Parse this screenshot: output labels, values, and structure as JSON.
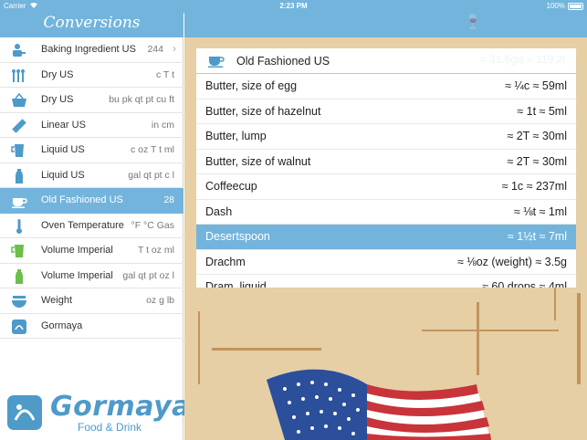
{
  "status_bar": {
    "carrier": "Carrier",
    "time": "2:23 PM",
    "battery": "100%"
  },
  "sidebar": {
    "title": "Conversions",
    "items": [
      {
        "label": "Baking Ingredient US",
        "detail": "244",
        "icon": "baking-ingredient-icon",
        "chevron": true,
        "selected": false
      },
      {
        "label": "Dry US",
        "detail": "c T t",
        "icon": "utensils-icon",
        "selected": false
      },
      {
        "label": "Dry US",
        "detail": "bu pk qt pt cu ft",
        "icon": "basket-icon",
        "selected": false
      },
      {
        "label": "Linear US",
        "detail": "in cm",
        "icon": "ruler-icon",
        "selected": false
      },
      {
        "label": "Liquid US",
        "detail": "c oz T t ml",
        "icon": "measuring-cup-icon",
        "selected": false
      },
      {
        "label": "Liquid US",
        "detail": "gal qt pt c l",
        "icon": "milk-bottle-icon",
        "selected": false
      },
      {
        "label": "Old Fashioned US",
        "detail": "28",
        "icon": "teacup-icon",
        "selected": true
      },
      {
        "label": "Oven Temperature",
        "detail": "°F °C Gas",
        "icon": "thermometer-icon",
        "selected": false
      },
      {
        "label": "Volume Imperial",
        "detail": "T t oz ml",
        "icon": "measuring-jug-icon",
        "selected": false
      },
      {
        "label": "Volume Imperial",
        "detail": "gal qt pt oz l",
        "icon": "bottle-icon",
        "selected": false
      },
      {
        "label": "Weight",
        "detail": "oz g lb",
        "icon": "scale-icon",
        "selected": false
      },
      {
        "label": "Gormaya",
        "detail": "",
        "icon": "gormaya-logo-icon",
        "selected": false
      }
    ]
  },
  "brand": {
    "name": "Gormaya",
    "tagline": "Food & Drink"
  },
  "detail": {
    "title": "Old Fashioned US",
    "header_ghost": "≈ 31.6gill ≈ 119.2l",
    "rows": [
      {
        "label": "Butter, size of egg",
        "value": "≈ ¼c ≈ 59ml",
        "selected": false
      },
      {
        "label": "Butter, size of hazelnut",
        "value": "≈ 1t ≈ 5ml",
        "selected": false
      },
      {
        "label": "Butter, lump",
        "value": "≈ 2T ≈ 30ml",
        "selected": false
      },
      {
        "label": "Butter, size of walnut",
        "value": "≈ 2T ≈ 30ml",
        "selected": false
      },
      {
        "label": "Coffeecup",
        "value": "≈ 1c ≈ 237ml",
        "selected": false
      },
      {
        "label": "Dash",
        "value": "≈ ⅛t ≈ 1ml",
        "selected": false
      },
      {
        "label": "Desertspoon",
        "value": "≈ 1½t ≈ 7ml",
        "selected": true
      },
      {
        "label": "Drachm",
        "value": "≈ ⅛oz (weight) ≈ 3.5g",
        "selected": false
      },
      {
        "label": "Dram, liquid",
        "value": "≈ 60 drops ≈ 4ml",
        "selected": false
      }
    ]
  },
  "colors": {
    "accent": "#72b4dc",
    "poster_bg": "#e6cfa4",
    "flag_red": "#c8343a",
    "flag_blue": "#2b4f9a",
    "brand_blue": "#4e9ac9"
  }
}
